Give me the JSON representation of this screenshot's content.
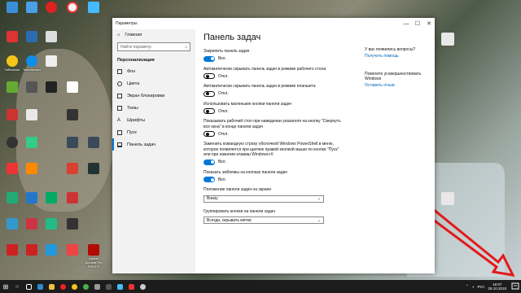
{
  "window": {
    "title": "Параметры",
    "controls": {
      "minimize": "—",
      "maximize": "☐",
      "close": "✕"
    }
  },
  "sidebar": {
    "home": "Главная",
    "search_placeholder": "Найти параметр",
    "category": "Персонализация",
    "items": [
      {
        "label": "Фон"
      },
      {
        "label": "Цвета"
      },
      {
        "label": "Экран блокировки"
      },
      {
        "label": "Темы"
      },
      {
        "label": "Шрифты"
      },
      {
        "label": "Пуск"
      },
      {
        "label": "Панель задач"
      }
    ]
  },
  "main": {
    "title": "Панель задач",
    "settings": [
      {
        "label": "Закрепить панель задач",
        "state": "Вкл."
      },
      {
        "label": "Автоматически скрывать панель задач в режиме рабочего стола",
        "state": "Откл."
      },
      {
        "label": "Автоматически скрывать панель задач в режиме планшета",
        "state": "Откл."
      },
      {
        "label": "Использовать маленькие кнопки панели задач",
        "state": "Откл."
      },
      {
        "label": "Показывать рабочий стол при наведении указателя на кнопку \"Свернуть все окна\" в конце панели задач",
        "state": "Откл."
      },
      {
        "label": "Заменить командную строку оболочкой Windows PowerShell в меню, которое появляется при щелчке правой кнопкой мыши по кнопке \"Пуск\" или при нажатии клавиш Windows+X",
        "state": "Вкл."
      },
      {
        "label": "Показать эмблемы на кнопках панели задач",
        "state": "Вкл."
      }
    ],
    "position_label": "Положение панели задач на экране",
    "position_value": "Внизу",
    "group_label": "Группировать кнопки на панели задач",
    "group_value": "Всегда, скрывать метки"
  },
  "right": {
    "question": "У вас появились вопросы?",
    "help_link": "Получить помощь",
    "improve": "Помогите усовершенствовать Windows",
    "feedback_link": "Оставить отзыв"
  },
  "desktop_icons": [
    {
      "label": ""
    },
    {
      "label": ""
    },
    {
      "label": ""
    },
    {
      "label": "YaBrowser"
    },
    {
      "label": "TeamViewer"
    },
    {
      "label": ""
    },
    {
      "label": ""
    },
    {
      "label": ""
    },
    {
      "label": "Adobe Acrobat Pro PHOTO"
    }
  ],
  "taskbar": {
    "lang": "РУС",
    "time": "16:07",
    "date": "29.10.2018"
  }
}
